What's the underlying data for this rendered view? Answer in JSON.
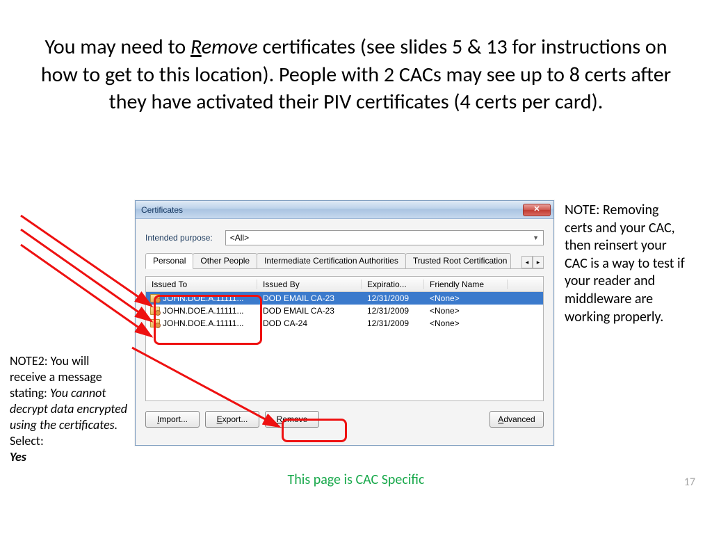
{
  "title": {
    "pre": "You may need to ",
    "em_u": "R",
    "em": "emove",
    "post": " certificates (see slides 5 & 13 for instructions on how to get to this location).  People with 2 CACs may see up to 8 certs after they have activated their PIV certificates (4 certs per card)."
  },
  "dialog": {
    "title": "Certificates",
    "close": "✕",
    "purpose_label": "Intended purpose:",
    "purpose_value": "<All>",
    "tabs": [
      "Personal",
      "Other People",
      "Intermediate Certification Authorities",
      "Trusted Root Certification"
    ],
    "tab_nav": {
      "left": "◂",
      "right": "▸"
    },
    "columns": [
      "Issued To",
      "Issued By",
      "Expiratio...",
      "Friendly Name"
    ],
    "rows": [
      {
        "issued_to": "JOHN.DOE.A.11111...",
        "issued_by": "DOD EMAIL CA-23",
        "exp": "12/31/2009",
        "friendly": "<None>"
      },
      {
        "issued_to": "JOHN.DOE.A.11111...",
        "issued_by": "DOD EMAIL CA-23",
        "exp": "12/31/2009",
        "friendly": "<None>"
      },
      {
        "issued_to": "JOHN.DOE.A.11111...",
        "issued_by": "DOD CA-24",
        "exp": "12/31/2009",
        "friendly": "<None>"
      }
    ],
    "buttons": {
      "import": {
        "u": "I",
        "rest": "mport..."
      },
      "export": {
        "u": "E",
        "rest": "xport..."
      },
      "remove": {
        "u": "R",
        "rest": "emove"
      },
      "advanced": {
        "u": "A",
        "rest": "dvanced"
      }
    }
  },
  "note_right": "NOTE:  Removing certs and your CAC, then reinsert your CAC is a way to test if your reader and middleware are working properly.",
  "note_left": {
    "lead": "NOTE2:  You will receive a message stating:  ",
    "italic": "You cannot decrypt data encrypted using the certificates.",
    "tail": "  Select:",
    "bold": "Yes"
  },
  "footer": "This page is CAC Specific",
  "page": "17"
}
